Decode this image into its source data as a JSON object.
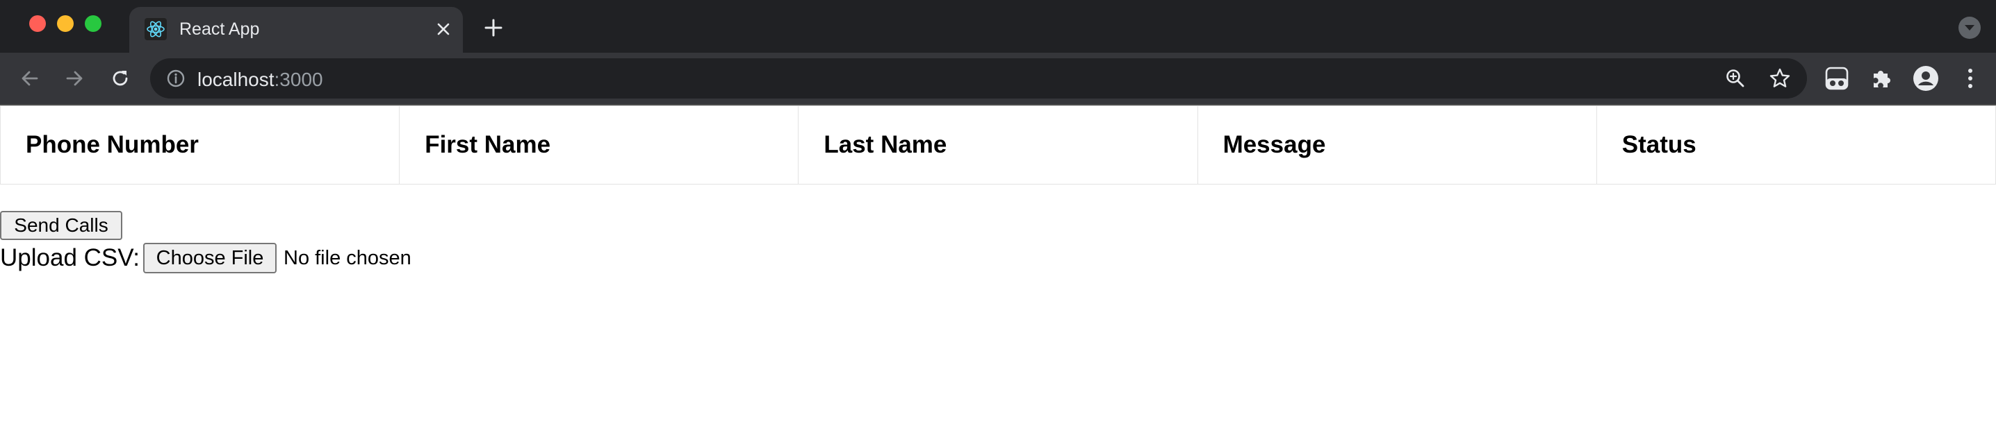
{
  "browser": {
    "tab": {
      "title": "React App",
      "favicon": "react-logo-icon"
    },
    "address_bar": {
      "host": "localhost",
      "port": ":3000"
    },
    "icons": [
      "back-icon",
      "forward-icon",
      "reload-icon",
      "site-info-icon",
      "zoom-icon",
      "bookmark-star-icon",
      "extension-icon",
      "puzzle-icon",
      "profile-icon",
      "menu-icon"
    ],
    "colors": {
      "tabstrip": "#202124",
      "toolbar": "#35363a",
      "omnibox": "#202124"
    }
  },
  "table": {
    "headers": [
      "Phone Number",
      "First Name",
      "Last Name",
      "Message",
      "Status"
    ]
  },
  "actions": {
    "send_label": "Send Calls",
    "upload_label": "Upload CSV:",
    "choose_file_label": "Choose File",
    "file_status": "No file chosen"
  }
}
